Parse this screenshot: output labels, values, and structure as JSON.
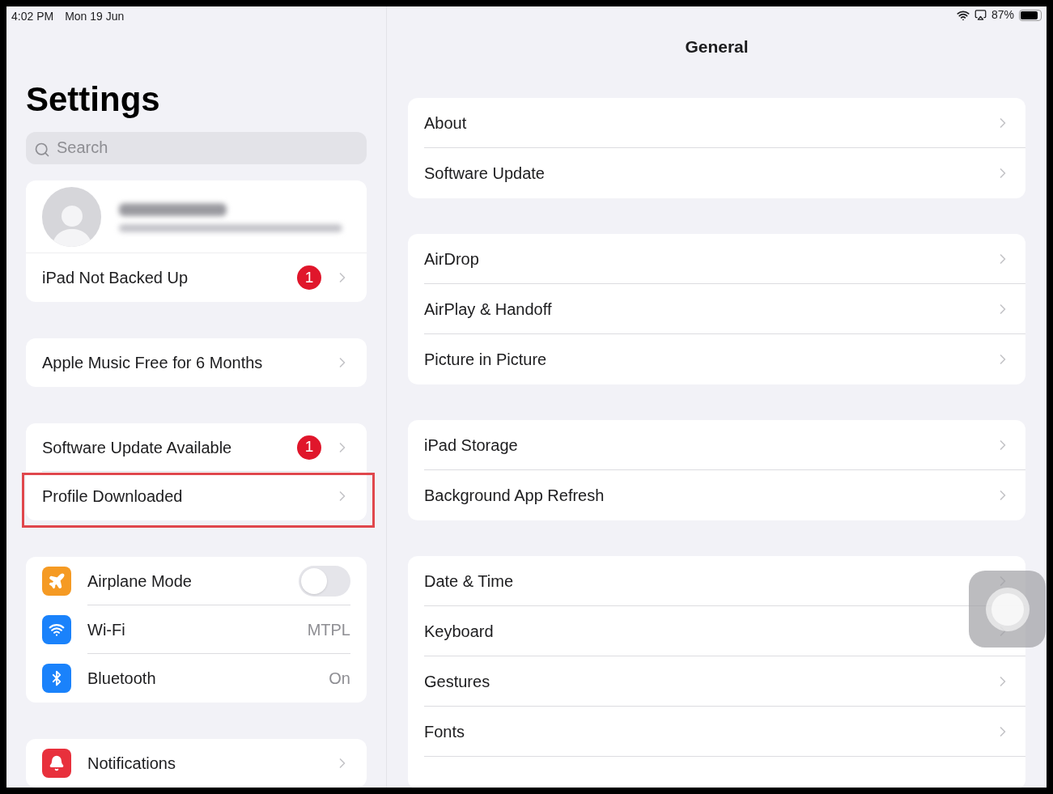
{
  "status_bar": {
    "time": "4:02 PM",
    "date": "Mon 19 Jun",
    "battery": "87%"
  },
  "sidebar": {
    "title": "Settings",
    "search": {
      "placeholder": "Search"
    },
    "groups": [
      {
        "kind": "account",
        "rows": [
          {
            "kind": "link",
            "label": "iPad Not Backed Up",
            "badge": "1",
            "highlighted": false
          }
        ]
      },
      {
        "kind": "plain",
        "rows": [
          {
            "kind": "link",
            "label": "Apple Music Free for 6 Months",
            "highlighted": false
          }
        ]
      },
      {
        "kind": "plain",
        "rows": [
          {
            "kind": "link",
            "label": "Software Update Available",
            "badge": "1",
            "highlighted": false
          },
          {
            "kind": "link",
            "label": "Profile Downloaded",
            "highlighted": true
          }
        ]
      },
      {
        "kind": "icons",
        "rows": [
          {
            "kind": "toggle",
            "label": "Airplane Mode",
            "on": false,
            "color": "#f59a23"
          },
          {
            "kind": "value",
            "label": "Wi-Fi",
            "value": "MTPL",
            "color": "#1a82fb"
          },
          {
            "kind": "value",
            "label": "Bluetooth",
            "value": "On",
            "color": "#1a82fb"
          }
        ]
      },
      {
        "kind": "icons",
        "rows": [
          {
            "kind": "link",
            "label": "Notifications",
            "color": "#e8303c"
          }
        ]
      }
    ]
  },
  "detail": {
    "title": "General",
    "groups": [
      [
        {
          "label": "About"
        },
        {
          "label": "Software Update"
        }
      ],
      [
        {
          "label": "AirDrop"
        },
        {
          "label": "AirPlay & Handoff"
        },
        {
          "label": "Picture in Picture"
        }
      ],
      [
        {
          "label": "iPad Storage"
        },
        {
          "label": "Background App Refresh"
        }
      ],
      [
        {
          "label": "Date & Time"
        },
        {
          "label": "Keyboard"
        },
        {
          "label": "Gestures"
        },
        {
          "label": "Fonts"
        }
      ]
    ]
  }
}
